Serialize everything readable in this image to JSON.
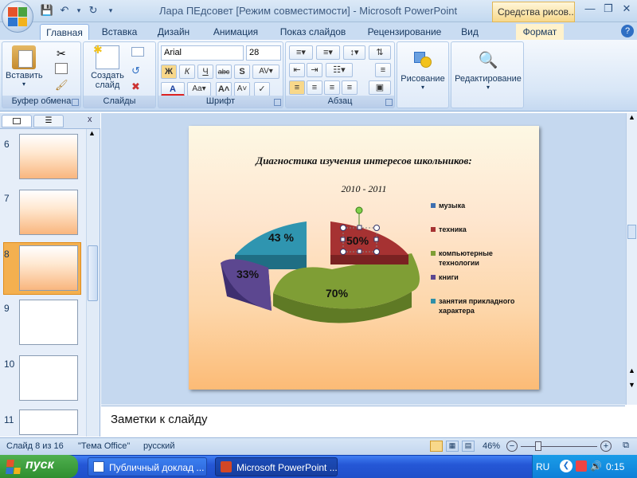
{
  "titlebar": {
    "title": "Лара ПЕдсовет [Режим совместимости] - Microsoft PowerPoint",
    "contextual_tab": "Средства рисов..."
  },
  "tabs": [
    "Главная",
    "Вставка",
    "Дизайн",
    "Анимация",
    "Показ слайдов",
    "Рецензирование",
    "Вид",
    "Формат"
  ],
  "ribbon": {
    "clipboard": {
      "paste": "Вставить",
      "label": "Буфер обмена"
    },
    "slides": {
      "create_line1": "Создать",
      "create_line2": "слайд",
      "label": "Слайды"
    },
    "font": {
      "name": "Arial",
      "size": "28",
      "label": "Шрифт",
      "bold": "Ж",
      "italic": "К",
      "underline": "Ч",
      "strike": "abc",
      "shadow": "S"
    },
    "paragraph": {
      "label": "Абзац"
    },
    "drawing": {
      "label": "Рисование"
    },
    "editing": {
      "label": "Редактирование"
    }
  },
  "thumbnails": [
    {
      "num": "6"
    },
    {
      "num": "7"
    },
    {
      "num": "8"
    },
    {
      "num": "9"
    },
    {
      "num": "10"
    },
    {
      "num": "11"
    }
  ],
  "slide": {
    "title": "Диагностика изучения интересов школьников:",
    "subtitle": "2010 - 2011",
    "labels": {
      "music": "50%",
      "cs": "70%",
      "books": "33%",
      "applied": "43 %"
    }
  },
  "chart_data": {
    "type": "pie",
    "title": "Диагностика изучения интересов школьников:",
    "subtitle": "2010 - 2011",
    "categories": [
      "музыка",
      "техника",
      "компьютерные технологии",
      "книги",
      "занятия прикладного характера"
    ],
    "values": [
      0,
      50,
      70,
      33,
      43
    ],
    "data_labels": [
      "",
      "50%",
      "70%",
      "33%",
      "43 %"
    ],
    "legend_placement": "right",
    "colors": [
      "#3e6fb0",
      "#a63232",
      "#7f9e35",
      "#5c4790",
      "#2f8fa8"
    ]
  },
  "legend": [
    {
      "label": "музыка",
      "color": "#3e6fb0"
    },
    {
      "label": "техника",
      "color": "#a63232"
    },
    {
      "label": "компьютерные технологии",
      "color": "#7f9e35"
    },
    {
      "label": "книги",
      "color": "#5c4790"
    },
    {
      "label": "занятия прикладного характера",
      "color": "#2f8fa8"
    }
  ],
  "notes": {
    "text": "Заметки к слайду"
  },
  "status": {
    "slide": "Слайд 8 из 16",
    "theme": "\"Тема Office\"",
    "lang": "русский",
    "zoom": "46%"
  },
  "taskbar": {
    "start": "пуск",
    "task1": "Публичный доклад ...",
    "task2": "Microsoft PowerPoint ...",
    "lang": "RU",
    "time": "0:15"
  }
}
